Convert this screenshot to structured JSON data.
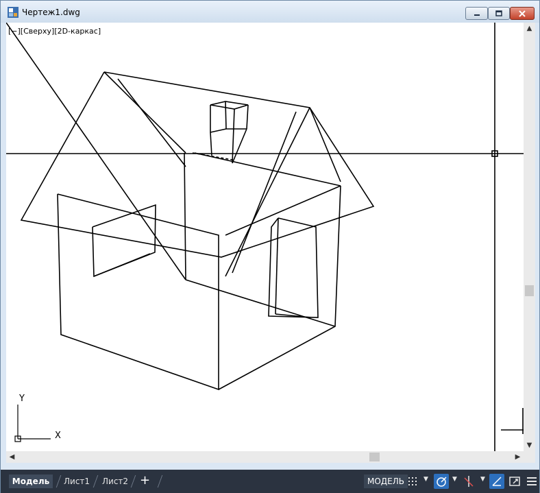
{
  "window": {
    "title": "Чертеж1.dwg"
  },
  "viewport": {
    "label": "[−][Сверху][2D-каркас]"
  },
  "ucs": {
    "x_label": "X",
    "y_label": "Y"
  },
  "layout_tabs": [
    {
      "label": "Модель",
      "active": true
    },
    {
      "label": "Лист1",
      "active": false
    },
    {
      "label": "Лист2",
      "active": false
    }
  ],
  "add_tab_label": "+",
  "status": {
    "model_label": "МОДЕЛЬ"
  },
  "colors": {
    "statusbar": "#2b3340",
    "active_toggle": "#2c6fbd",
    "drawing_background": "#ffffff",
    "line": "#000000"
  }
}
